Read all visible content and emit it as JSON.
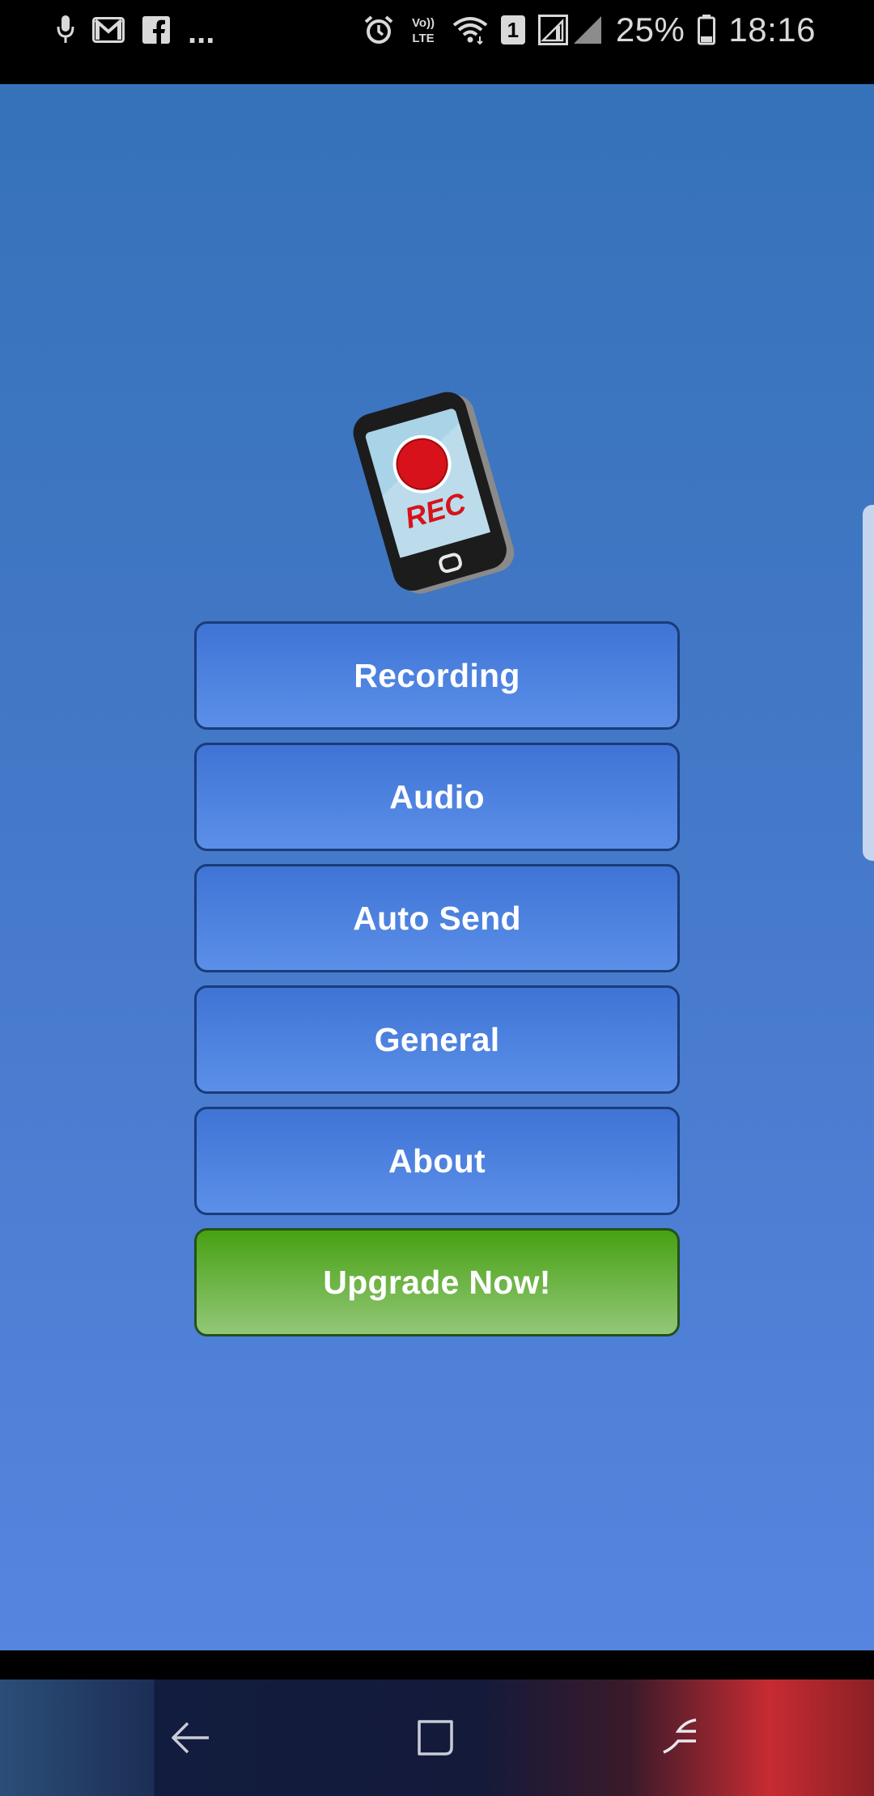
{
  "status_bar": {
    "overflow": "...",
    "sim_slot": "1",
    "battery_percent": "25%",
    "time": "18:16",
    "icons": [
      "mic-icon",
      "gmail-icon",
      "facebook-icon",
      "alarm-icon",
      "volte-icon",
      "wifi-icon",
      "signal-icon",
      "battery-icon"
    ]
  },
  "logo": {
    "label": "REC"
  },
  "menu": {
    "items": [
      {
        "label": "Recording"
      },
      {
        "label": "Audio"
      },
      {
        "label": "Auto Send"
      },
      {
        "label": "General"
      },
      {
        "label": "About"
      }
    ],
    "upgrade_label": "Upgrade Now!"
  },
  "nav_bar": {
    "icons": [
      "back-icon",
      "home-icon",
      "recents-icon"
    ]
  },
  "colors": {
    "background_top": "#3572b9",
    "background_bottom": "#5585df",
    "button_blue": "#4a80de",
    "button_border": "#1a3c7a",
    "upgrade_green": "#47a112",
    "rec_red": "#d8121a"
  }
}
